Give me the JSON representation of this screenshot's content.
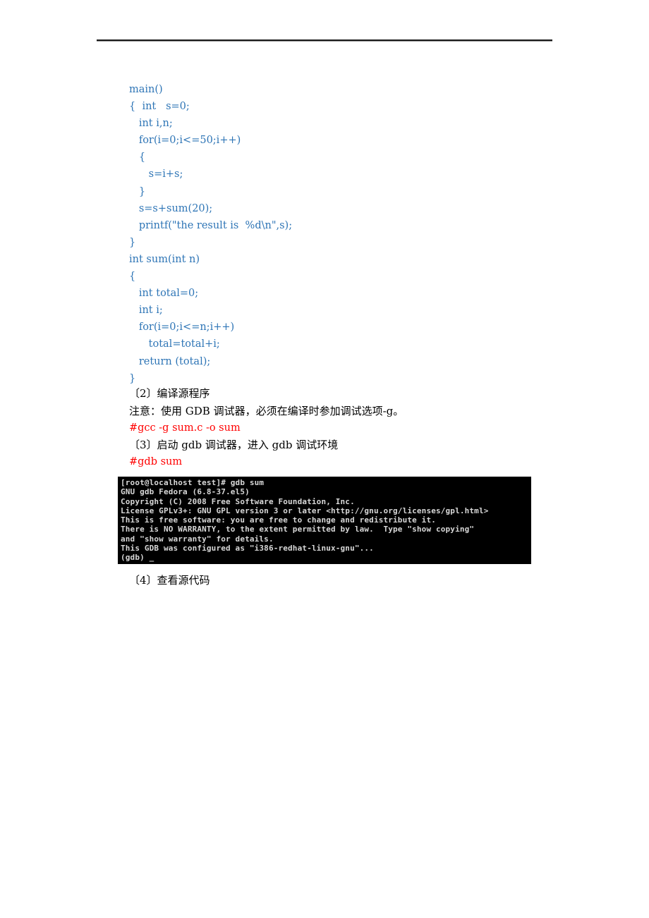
{
  "code_lines": [
    "main()",
    "{  int   s=0;",
    "   int i,n;",
    "   for(i=0;i<=50;i++)",
    "   {",
    "      s=i+s;",
    "   }",
    "   s=s+sum(20);",
    "   printf(\"the result is  %d\\n\",s);",
    "}",
    "int sum(int n)",
    "{",
    "   int total=0;",
    "   int i;",
    "   for(i=0;i<=n;i++)",
    "      total=total+i;",
    "   return (total);",
    "}"
  ],
  "steps": {
    "step2_heading": "〔2〕编译源程序",
    "step2_note": "注意：使用 GDB 调试器，必须在编译时参加调试选项-g。",
    "step2_command": "#gcc -g sum.c -o sum",
    "step3_heading": "〔3〕启动 gdb 调试器，进入 gdb 调试环境",
    "step3_command": "#gdb sum",
    "step4_heading": "〔4〕查看源代码"
  },
  "terminal_lines": [
    "[root@localhost test]# gdb sum",
    "GNU gdb Fedora (6.8-37.el5)",
    "Copyright (C) 2008 Free Software Foundation, Inc.",
    "License GPLv3+: GNU GPL version 3 or later <http://gnu.org/licenses/gpl.html>",
    "This is free software: you are free to change and redistribute it.",
    "There is NO WARRANTY, to the extent permitted by law.  Type \"show copying\"",
    "and \"show warranty\" for details.",
    "This GDB was configured as \"i386-redhat-linux-gnu\"...",
    "(gdb) _"
  ],
  "colors": {
    "code": "#2e75b6",
    "command": "#ff0000",
    "terminal_bg": "#000000",
    "terminal_fg": "#d8d8d8"
  }
}
